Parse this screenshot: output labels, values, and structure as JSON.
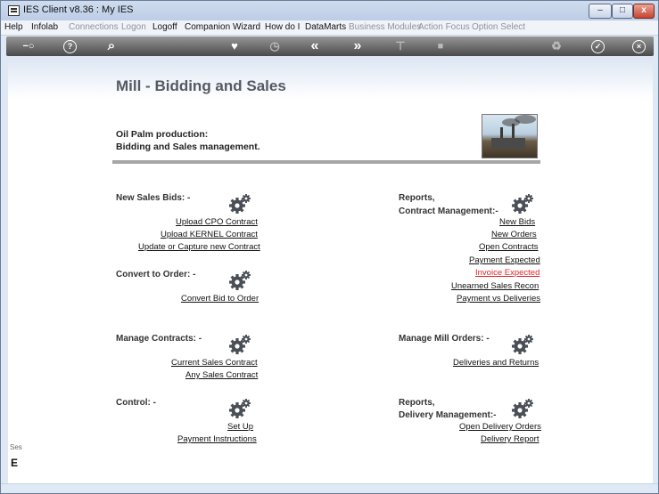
{
  "window": {
    "title": "IES Client v8.36 : My IES",
    "min_label": "–",
    "max_label": "□",
    "close_label": "x"
  },
  "menu": {
    "items": [
      {
        "label": "Help",
        "disabled": false
      },
      {
        "label": "Infolab",
        "disabled": false
      },
      {
        "label": "Connections",
        "disabled": true
      },
      {
        "label": "Logon",
        "disabled": true
      },
      {
        "label": "Logoff",
        "disabled": false
      },
      {
        "label": "Companion",
        "disabled": false
      },
      {
        "label": "Wizard",
        "disabled": false
      },
      {
        "label": "How do I",
        "disabled": false
      },
      {
        "label": "DataMarts",
        "disabled": false
      },
      {
        "label": "Business Modules",
        "disabled": true
      },
      {
        "label": "Action Focus",
        "disabled": true
      },
      {
        "label": "Option Select",
        "disabled": true
      }
    ]
  },
  "toolbar": {
    "icons": [
      "key-icon",
      "help-icon",
      "search-icon",
      "heart-icon",
      "clock-icon",
      "back-icon",
      "forward-icon",
      "pin-icon",
      "stop-icon",
      "recycle-icon",
      "ok-icon",
      "close-icon"
    ],
    "help_glyph": "?",
    "search_glyph": "⌕",
    "heart_glyph": "♥",
    "clock_glyph": "◷",
    "back_glyph": "«",
    "forward_glyph": "»",
    "pin_glyph": "⊤",
    "stop_glyph": "■",
    "recycle_glyph": "♻",
    "ok_glyph": "✓",
    "close_glyph": "×",
    "key_glyph": "−○"
  },
  "page": {
    "title": "Mill - Bidding and Sales",
    "subtitle_line1": "Oil Palm production:",
    "subtitle_line2": "Bidding and Sales management."
  },
  "sections": {
    "new_sales_bids": {
      "label": "New Sales Bids: -",
      "links": [
        "Upload CPO Contract",
        "Upload KERNEL Contract",
        "Update or Capture new Contract"
      ]
    },
    "convert_to_order": {
      "label": "Convert to Order: -",
      "links": [
        "Convert Bid to Order"
      ]
    },
    "manage_contracts": {
      "label": "Manage Contracts: -",
      "links": [
        "Current Sales Contract",
        "Any Sales Contract"
      ]
    },
    "control": {
      "label": "Control: -",
      "links": [
        "Set Up",
        "Payment Instructions"
      ]
    },
    "reports_contract": {
      "label_line1": "Reports,",
      "label_line2": "Contract Management:-",
      "links": [
        "New Bids",
        "New Orders",
        "Open Contracts",
        "Payment Expected",
        "Invoice Expected",
        "Unearned Sales Recon",
        "Payment vs Deliveries"
      ]
    },
    "manage_mill_orders": {
      "label": "Manage Mill Orders: -",
      "links": [
        "Deliveries and Returns"
      ]
    },
    "reports_delivery": {
      "label_line1": "Reports,",
      "label_line2": "Delivery Management:-",
      "links": [
        "Open Delivery Orders",
        "Delivery Report"
      ]
    }
  },
  "status": {
    "text": "Ses",
    "glyph": "E"
  },
  "colors": {
    "highlight_link": "#e0242a",
    "toolbar": "#5a5a5a",
    "title_text": "#555a62"
  }
}
